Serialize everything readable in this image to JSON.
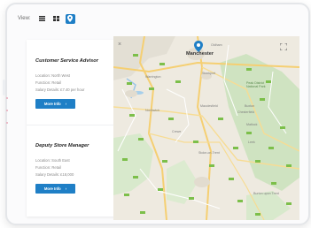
{
  "toolbar": {
    "view_label": "View:",
    "icons": [
      "list-icon",
      "grid-icon",
      "map-pin-icon"
    ],
    "active": "map-pin-icon",
    "accent": "#1f7fc6"
  },
  "jobs": [
    {
      "title": "Customer Service Advisor",
      "location": "Location: North West",
      "function": "Function: Retail",
      "salary": "Salary Details: £7.40 per hour",
      "button": "More Info"
    },
    {
      "title": "Deputy Store Manager",
      "location": "Location: South East",
      "function": "Function: Retail",
      "salary": "Salary Details: £18,000",
      "button": "More Info"
    }
  ],
  "map": {
    "city_pin_label": "Manchester",
    "labels": [
      "Oldham",
      "Warrington",
      "Stockport",
      "Macclesfield",
      "Buxton",
      "Peak District National Park",
      "Stoke-on-Trent",
      "Northwich",
      "Crewe",
      "Leek",
      "Chesterfield",
      "Matlock",
      "Burton upon Trent"
    ]
  },
  "colors": {
    "button": "#1f7fc6",
    "map_base": "#eeeae0",
    "map_park": "#cfe3c1",
    "road_major": "#f5cf72",
    "motorway_shield": "#7cbf4a"
  }
}
